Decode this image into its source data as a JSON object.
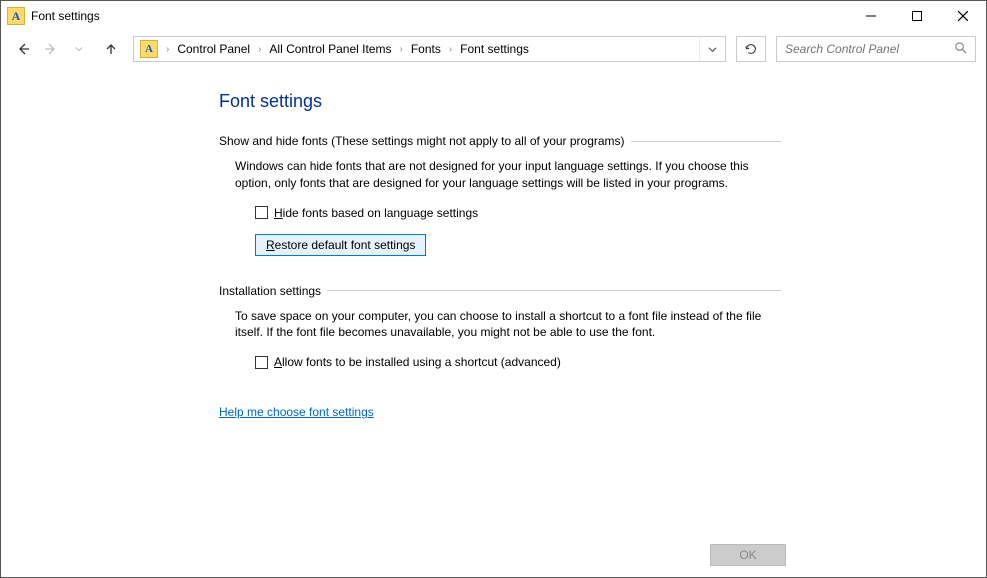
{
  "titlebar": {
    "title": "Font settings"
  },
  "breadcrumbs": {
    "items": [
      "Control Panel",
      "All Control Panel Items",
      "Fonts",
      "Font settings"
    ]
  },
  "search": {
    "placeholder": "Search Control Panel"
  },
  "page": {
    "title": "Font settings"
  },
  "group1": {
    "header": "Show and hide fonts (These settings might not apply to all of your programs)",
    "desc": "Windows can hide fonts that are not designed for your input language settings. If you choose this option, only fonts that are designed for your language settings will be listed in your programs.",
    "checkbox_label_pre": "H",
    "checkbox_label_rest": "ide fonts based on language settings",
    "restore_pre": "R",
    "restore_rest": "estore default font settings"
  },
  "group2": {
    "header": "Installation settings",
    "desc": "To save space on your computer, you can choose to install a shortcut to a font file instead of the file itself. If the font file becomes unavailable, you might not be able to use the font.",
    "checkbox_label_pre": "A",
    "checkbox_label_rest": "llow fonts to be installed using a shortcut (advanced)"
  },
  "link": {
    "label": "Help me choose font settings"
  },
  "footer": {
    "ok": "OK"
  }
}
